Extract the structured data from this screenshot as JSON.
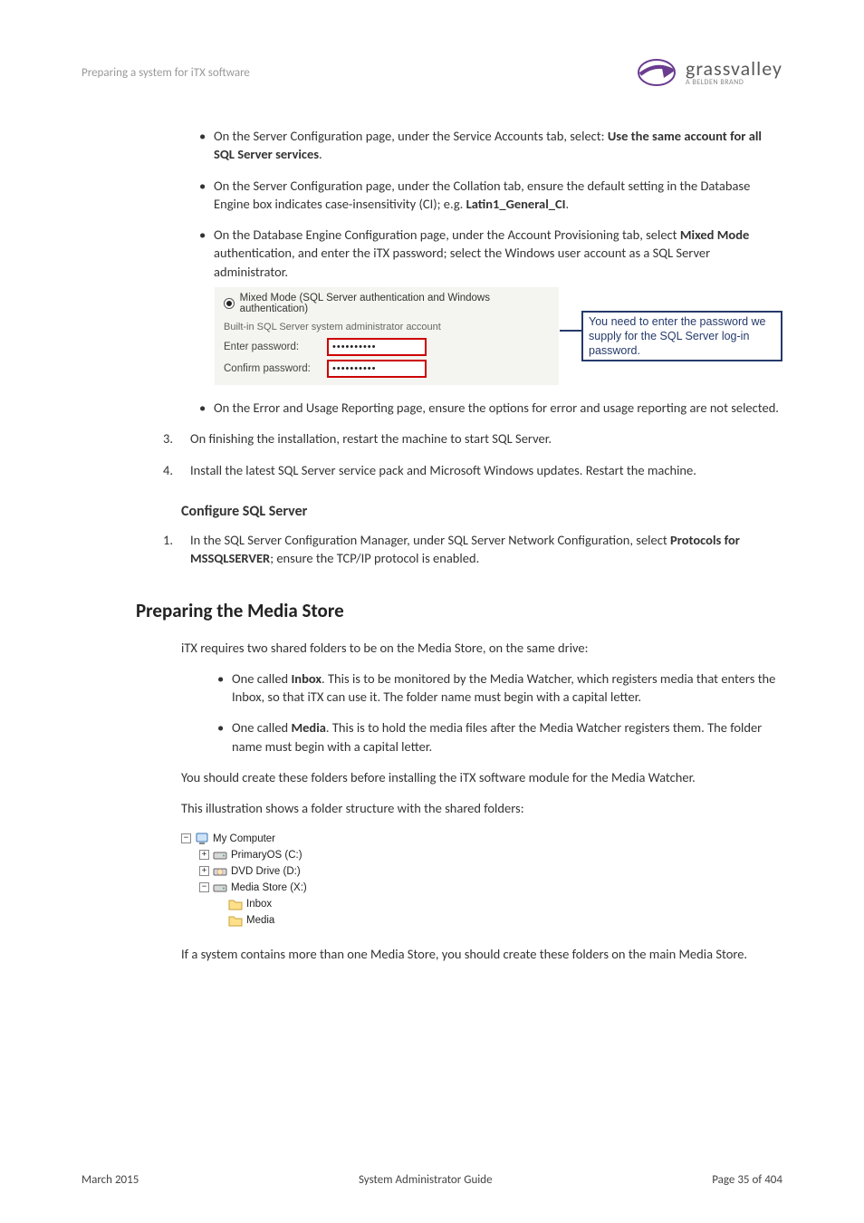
{
  "header": {
    "running_head": "Preparing a system for iTX software",
    "logo_main": "grassvalley",
    "logo_sub": "A BELDEN BRAND"
  },
  "b1": {
    "pre": "On the Server Configuration page, under the Service Accounts tab, select: ",
    "bold": "Use the same account for all SQL Server services",
    "post": "."
  },
  "b2": {
    "pre": "On the Server Configuration page, under the Collation tab, ensure the default setting in the Database Engine box indicates case-insensitivity (CI); e.g. ",
    "bold": "Latin1_General_CI",
    "post": "."
  },
  "b3": {
    "pre": "On the Database Engine Configuration page, under the Account Provisioning tab, select ",
    "bold": "Mixed Mode",
    "post": " authentication, and enter the iTX password; select the Windows user account as a SQL Server administrator."
  },
  "sql": {
    "radio_label": "Mixed Mode (SQL Server authentication and Windows authentication)",
    "fieldset": "Built-in SQL Server system administrator account",
    "enter_label": "Enter password:",
    "confirm_label": "Confirm password:",
    "pw": "••••••••••",
    "annot": "You need to enter the password we supply for the SQL Server log-in password."
  },
  "b4": "On the Error and Usage Reporting page, ensure the options for error and usage reporting are not selected.",
  "n3": "On finishing the installation, restart the machine to start SQL Server.",
  "n4": "Install the latest SQL Server service pack and Microsoft Windows updates. Restart the machine.",
  "h_configure": "Configure SQL Server",
  "cfg1": {
    "pre": "In the SQL Server Configuration Manager, under SQL Server Network Configuration, select ",
    "bold": "Protocols for MSSQLSERVER",
    "post": "; ensure the TCP/IP protocol is enabled."
  },
  "h_media": "Preparing the Media Store",
  "media_intro": "iTX requires two shared folders to be on the Media Store, on the same drive:",
  "mb1": {
    "pre": "One called ",
    "bold": "Inbox",
    "post": ". This is to be monitored by the Media Watcher, which registers media that enters the Inbox, so that iTX can use it. The folder name must begin with a capital letter."
  },
  "mb2": {
    "pre": "One called ",
    "bold": "Media",
    "post": ". This is to hold the media files after the Media Watcher registers them. The folder name must begin with a capital letter."
  },
  "media_p2": "You should create these folders before installing the iTX software module for the Media Watcher.",
  "media_p3": "This illustration shows a folder structure with the shared folders:",
  "tree": {
    "root": "My Computer",
    "primary": "PrimaryOS (C:)",
    "dvd": "DVD Drive (D:)",
    "mediastore": "Media Store (X:)",
    "inbox": "Inbox",
    "media": "Media"
  },
  "media_p4": "If a system contains more than one Media Store, you should create these folders on the main Media Store.",
  "footer": {
    "left": "March 2015",
    "center": "System Administrator Guide",
    "right": "Page 35 of 404"
  },
  "nums": {
    "n3": "3.",
    "n4": "4.",
    "n1": "1."
  }
}
